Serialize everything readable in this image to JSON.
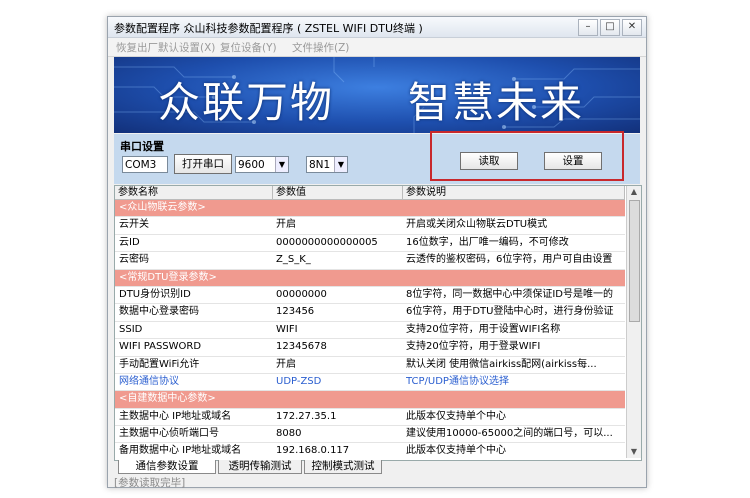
{
  "window": {
    "title": "参数配置程序  众山科技参数配置程序 ( ZSTEL WIFI DTU终端 )"
  },
  "menu": [
    "恢复出厂默认设置(X)",
    "复位设备(Y)",
    "文件操作(Z)"
  ],
  "banner": {
    "slogan_left": "众联万物",
    "slogan_right": "智慧未来"
  },
  "serial": {
    "legend": "串口设置",
    "port": "COM3",
    "open_label": "打开串口",
    "baud": "9600",
    "format": "8N1",
    "read_label": "读取",
    "set_label": "设置"
  },
  "table": {
    "headers": [
      "参数名称",
      "参数值",
      "参数说明"
    ],
    "rows": [
      {
        "type": "section",
        "name": "<众山物联云参数>",
        "value": "",
        "desc": ""
      },
      {
        "type": "normal",
        "name": "云开关",
        "value": "开启",
        "desc": "开启或关闭众山物联云DTU模式"
      },
      {
        "type": "normal",
        "name": "云ID",
        "value": "0000000000000005",
        "desc": "16位数字，出厂唯一编码，不可修改"
      },
      {
        "type": "normal",
        "name": "云密码",
        "value": "Z_S_K_",
        "desc": "云透传的鉴权密码，6位字符，用户可自由设置"
      },
      {
        "type": "section",
        "name": "<常规DTU登录参数>",
        "value": "",
        "desc": ""
      },
      {
        "type": "normal",
        "name": "DTU身份识别ID",
        "value": "00000000",
        "desc": "8位字符，同一数据中心中须保证ID号是唯一的"
      },
      {
        "type": "normal",
        "name": "数据中心登录密码",
        "value": "123456",
        "desc": "6位字符，用于DTU登陆中心时，进行身份验证"
      },
      {
        "type": "normal",
        "name": "SSID",
        "value": "WIFI",
        "desc": "支持20位字符，用于设置WIFI名称"
      },
      {
        "type": "normal",
        "name": "WIFI PASSWORD",
        "value": "12345678",
        "desc": "支持20位字符，用于登录WIFI"
      },
      {
        "type": "normal",
        "name": "手动配置WiFi允许",
        "value": "开启",
        "desc": "默认关闭 使用微信airkiss配网(airkiss每..."
      },
      {
        "type": "blue",
        "name": "网络通信协议",
        "value": "UDP-ZSD",
        "desc": "TCP/UDP通信协议选择"
      },
      {
        "type": "section",
        "name": "<自建数据中心参数>",
        "value": "",
        "desc": ""
      },
      {
        "type": "normal",
        "name": "主数据中心 IP地址或域名",
        "value": "172.27.35.1",
        "desc": "此版本仅支持单个中心"
      },
      {
        "type": "normal",
        "name": "主数据中心侦听端口号",
        "value": "8080",
        "desc": "建议使用10000-65000之间的端口号，可以..."
      },
      {
        "type": "normal",
        "name": "备用数据中心 IP地址或域名",
        "value": "192.168.0.117",
        "desc": "此版本仅支持单个中心"
      },
      {
        "type": "normal",
        "name": "备用数据中心侦听端口号",
        "value": "1000",
        "desc": "建议使用10000-65000之间的端口号，可以..."
      }
    ]
  },
  "tabs": [
    "通信参数设置",
    "透明传输测试",
    "控制模式测试"
  ],
  "status": "[参数读取完毕]",
  "colors": {
    "section_row": "#f09a8f",
    "highlight": "#c8282c",
    "serial_panel": "#c5d9ee"
  }
}
